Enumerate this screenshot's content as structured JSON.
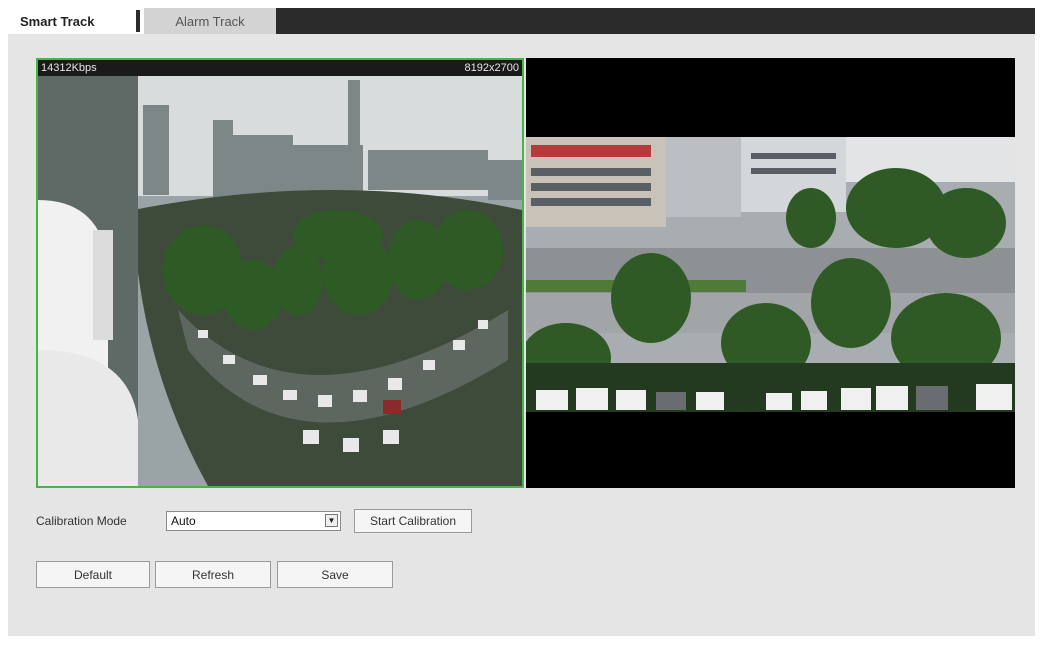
{
  "tabs": [
    {
      "label": "Smart Track",
      "active": true
    },
    {
      "label": "Alarm Track",
      "active": false
    }
  ],
  "video": {
    "bitrate": "14312Kbps",
    "resolution": "8192x2700"
  },
  "calibration": {
    "label": "Calibration Mode",
    "mode": "Auto",
    "start_label": "Start Calibration"
  },
  "buttons": {
    "default": "Default",
    "refresh": "Refresh",
    "save": "Save"
  },
  "colors": {
    "active_border": "#48b448",
    "tab_bar_dark": "#2b2b2b",
    "panel_bg": "#e5e5e5"
  }
}
